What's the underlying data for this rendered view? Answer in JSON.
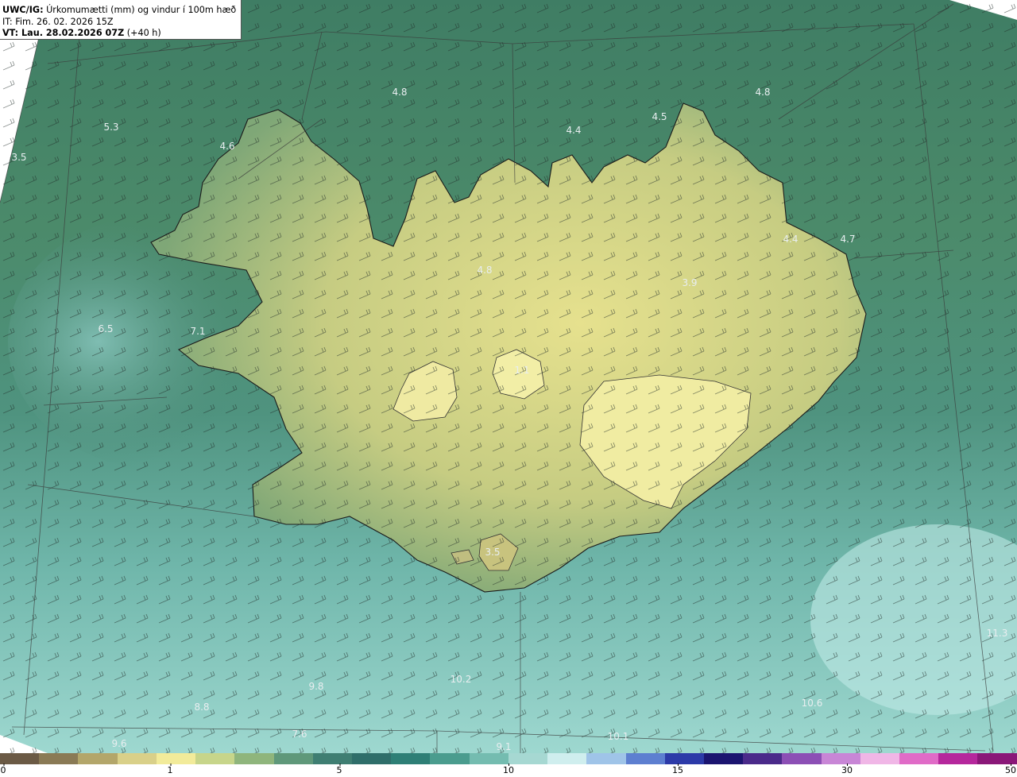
{
  "header": {
    "model": "UWC/IG:",
    "title": "Úrkomumætti (mm) og vindur í 100m hæð",
    "init_time": "IT: Fim. 26. 02. 2026 15Z",
    "valid_time_bold": "VT: Lau. 28.02.2026 07Z",
    "valid_time_offset": "(+40 h)"
  },
  "map_labels": [
    {
      "text": "4.8",
      "name": "value-label-north-sea"
    },
    {
      "text": "4.8",
      "name": "value-label-northeast-sea"
    },
    {
      "text": "5.3",
      "name": "value-label-northwest-sea"
    },
    {
      "text": "3.5",
      "name": "value-label-far-west"
    },
    {
      "text": "4.6",
      "name": "value-label-westfjords"
    },
    {
      "text": "4.4",
      "name": "value-label-north"
    },
    {
      "text": "4.5",
      "name": "value-label-northeast"
    },
    {
      "text": "4.8",
      "name": "value-label-central-north"
    },
    {
      "text": "3.9",
      "name": "value-label-northeast-highland"
    },
    {
      "text": "4.4",
      "name": "value-label-east"
    },
    {
      "text": "4.7",
      "name": "value-label-east-coast"
    },
    {
      "text": "6.5",
      "name": "value-label-west-sea"
    },
    {
      "text": "7.1",
      "name": "value-label-snaefellsnes"
    },
    {
      "text": "1.1",
      "name": "value-label-hofsjokull"
    },
    {
      "text": "3.5",
      "name": "value-label-myrdalsjokull"
    },
    {
      "text": "9.8",
      "name": "value-label-south-sea-1"
    },
    {
      "text": "10.2",
      "name": "value-label-south-sea-2"
    },
    {
      "text": "8.8",
      "name": "value-label-south-sea-3"
    },
    {
      "text": "7.6",
      "name": "value-label-south-sea-4"
    },
    {
      "text": "9.6",
      "name": "value-label-south-sea-5"
    },
    {
      "text": "10.1",
      "name": "value-label-south-sea-6"
    },
    {
      "text": "10.6",
      "name": "value-label-southeast-sea"
    },
    {
      "text": "9.1",
      "name": "value-label-south-sea-7"
    },
    {
      "text": "11.3",
      "name": "value-label-far-southeast"
    }
  ],
  "colorbar": {
    "ticks": [
      "0",
      "1",
      "5",
      "10",
      "15",
      "30",
      "50"
    ],
    "colors": [
      "#6b5a45",
      "#8a7a55",
      "#b3a66a",
      "#d9d089",
      "#f2eb9a",
      "#c7d58a",
      "#8fb57c",
      "#5f987a",
      "#3f7e72",
      "#2f6e6a",
      "#2e7f76",
      "#4a9c8e",
      "#74bcb0",
      "#a6d8d2",
      "#cfeeee",
      "#9fc4e8",
      "#5d7fd0",
      "#2c3aa8",
      "#1b1470",
      "#4a2a8a",
      "#8c4fb5",
      "#c886d6",
      "#f0b6e6",
      "#e06bc7",
      "#b5279c",
      "#8a1778"
    ]
  },
  "style": {
    "land_high": "#eae690",
    "land_mid": "#a5b878",
    "sea_north": "#4c8a6e",
    "sea_south": "#7cc2b8"
  }
}
